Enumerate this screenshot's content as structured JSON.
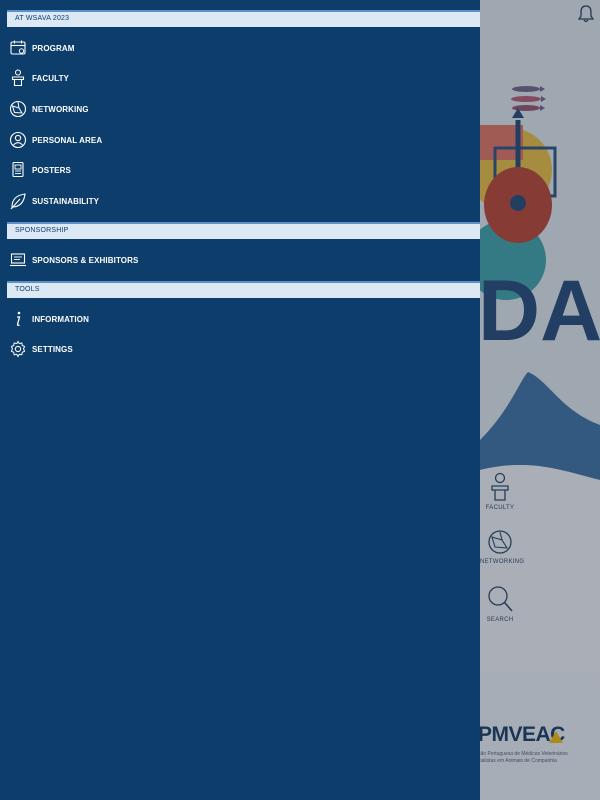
{
  "drawer": {
    "sections": [
      {
        "header": "AT WSAVA 2023",
        "items": [
          {
            "label": "PROGRAM",
            "icon": "calendar-icon"
          },
          {
            "label": "FACULTY",
            "icon": "speaker-icon"
          },
          {
            "label": "NETWORKING",
            "icon": "network-icon"
          },
          {
            "label": "PERSONAL AREA",
            "icon": "user-icon"
          },
          {
            "label": "POSTERS",
            "icon": "poster-icon"
          },
          {
            "label": "SUSTAINABILITY",
            "icon": "leaf-icon"
          }
        ]
      },
      {
        "header": "SPONSORSHIP",
        "items": [
          {
            "label": "SPONSORS & EXHIBITORS",
            "icon": "sponsor-icon"
          }
        ]
      },
      {
        "header": "TOOLS",
        "items": [
          {
            "label": "INFORMATION",
            "icon": "info-icon"
          },
          {
            "label": "SETTINGS",
            "icon": "gear-icon"
          }
        ]
      }
    ]
  },
  "background": {
    "quick_actions": [
      {
        "label": "FACULTY",
        "icon": "speaker-icon"
      },
      {
        "label": "NETWORKING",
        "icon": "network-icon"
      },
      {
        "label": "SEARCH",
        "icon": "search-icon"
      }
    ],
    "sponsor_logo": {
      "text": "PMVEAC",
      "subtitle_line1": "ção Portuguesa de Médicos Veterinários",
      "subtitle_line2": "cialistas em Animais de Companhia"
    }
  },
  "colors": {
    "drawer_bg": "#0c3d6b",
    "section_header_bg": "#dce9f5",
    "section_header_border": "#5d8fcb",
    "logo_accent": "#ecb300"
  }
}
